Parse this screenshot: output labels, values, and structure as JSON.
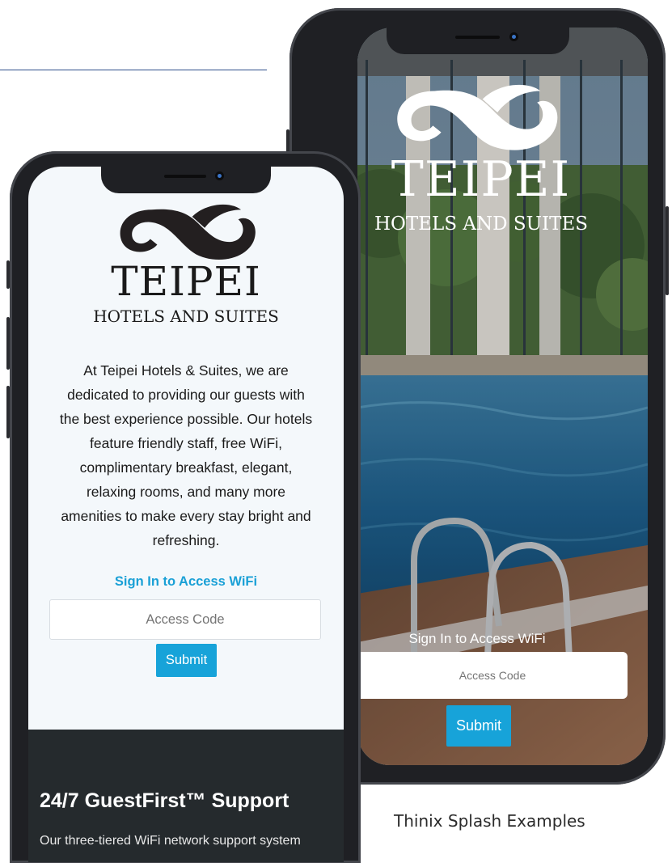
{
  "back_phone": {
    "brand": "TEIPEI",
    "subtitle": "HOTELS AND SUITES",
    "signin_label": "Sign In to Access WiFi",
    "access_code_placeholder": "Access Code",
    "submit_label": "Submit"
  },
  "front_phone": {
    "brand": "TEIPEI",
    "subtitle": "HOTELS AND SUITES",
    "description": "At Teipei Hotels & Suites, we are dedicated to providing our guests with the best experience possible. Our hotels feature friendly staff, free WiFi, complimentary breakfast, elegant, relaxing rooms, and many more amenities to make every stay bright and refreshing.",
    "signin_label": "Sign In to Access WiFi",
    "access_code_placeholder": "Access Code",
    "submit_label": "Submit",
    "support_title": "24/7 GuestFirst™ Support",
    "support_text": "Our three-tiered WiFi network support system"
  },
  "caption": "Thinix Splash Examples",
  "colors": {
    "accent": "#17a3d9",
    "dark_section": "#252a2d",
    "phone_frame": "#1f2024"
  }
}
